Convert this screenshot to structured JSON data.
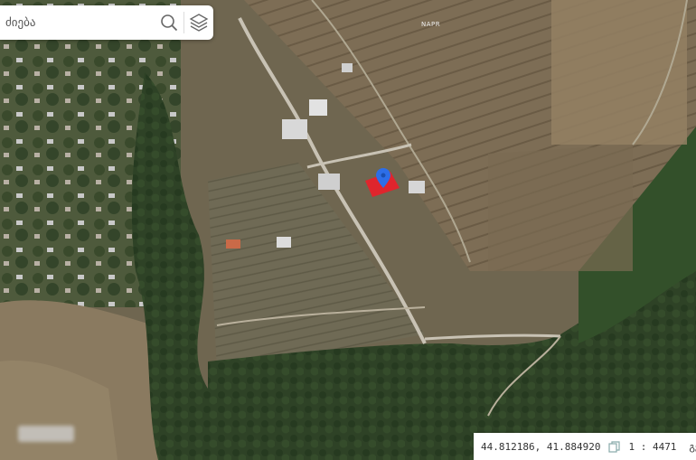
{
  "search": {
    "placeholder": "ძიება",
    "icons": [
      "search-icon",
      "layers-icon"
    ]
  },
  "map": {
    "road_label": "NAPR",
    "marker_color": "#2d6ee8",
    "parcel_color": "#e8202a"
  },
  "status_bar": {
    "coordinates": "44.812186, 41.884920",
    "scale": "1 : 4471",
    "basemap_label": "გეოგრაფიული",
    "icons": [
      "copy-icon"
    ]
  }
}
